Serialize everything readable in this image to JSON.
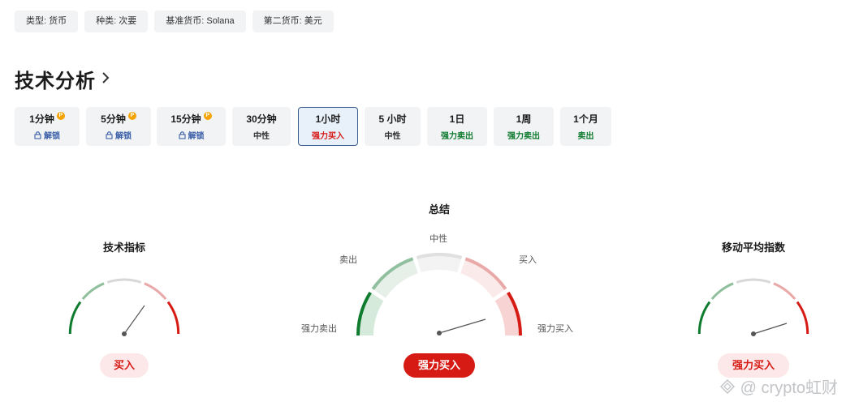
{
  "tags": [
    {
      "label": "类型: 货币"
    },
    {
      "label": "种类: 次要"
    },
    {
      "label": "基准货币: Solana"
    },
    {
      "label": "第二货币: 美元"
    }
  ],
  "section": {
    "title": "技术分析",
    "chevron_icon": "chevron-right-icon"
  },
  "periods": [
    {
      "label": "1分钟",
      "status": "解锁",
      "locked": true
    },
    {
      "label": "5分钟",
      "status": "解锁",
      "locked": true
    },
    {
      "label": "15分钟",
      "status": "解锁",
      "locked": true
    },
    {
      "label": "30分钟",
      "status": "中性",
      "locked": false
    },
    {
      "label": "1小时",
      "status": "强力买入",
      "locked": false,
      "active": true
    },
    {
      "label": "5 小时",
      "status": "中性",
      "locked": false
    },
    {
      "label": "1日",
      "status": "强力卖出",
      "locked": false
    },
    {
      "label": "1周",
      "status": "强力卖出",
      "locked": false
    },
    {
      "label": "1个月",
      "status": "卖出",
      "locked": false
    }
  ],
  "gauges": {
    "technical": {
      "title": "技术指标",
      "result": "买入"
    },
    "summary": {
      "title": "总结",
      "result": "强力买入",
      "labels": {
        "neutral": "中性",
        "sell": "卖出",
        "buy": "买入",
        "strong_sell": "强力卖出",
        "strong_buy": "强力买入"
      }
    },
    "moving_avg": {
      "title": "移动平均指数",
      "result": "强力买入"
    }
  },
  "watermark": "@ crypto虹财",
  "colors": {
    "sell": "#0f7b2e",
    "buy": "#d61a14",
    "active_border": "#3a5e8c",
    "link": "#3a5fa8"
  }
}
